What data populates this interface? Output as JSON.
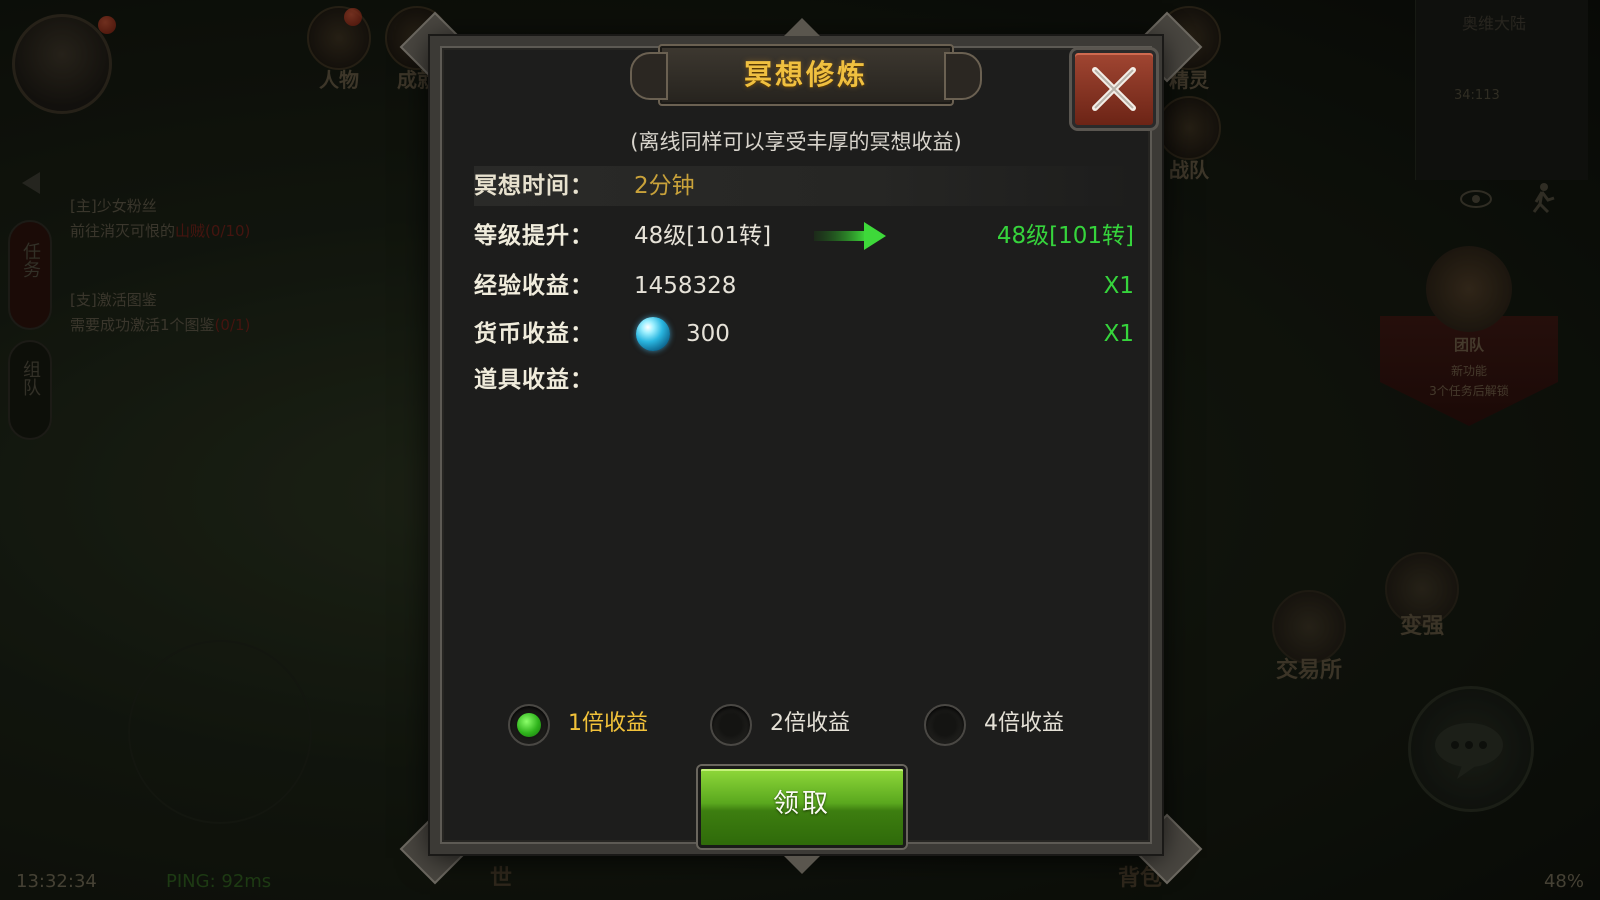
{
  "hud": {
    "top_icons": [
      "人物",
      "成就",
      "精灵",
      "战队"
    ],
    "quests": [
      {
        "title": "[主]少女粉丝",
        "desc": "前往消灭可恨的",
        "progress": "山贼(0/10)"
      },
      {
        "title": "[支]激活图鉴",
        "desc": "需要成功激活1个图鉴",
        "progress": "(0/1)"
      }
    ],
    "quest_tab": "任务",
    "team_tab": "组队",
    "minimap": {
      "name": "奥维大陆",
      "coord": "34:113"
    },
    "guild": {
      "title": "团队",
      "line1": "新功能",
      "line2": "3个任务后解锁"
    },
    "right_buttons": {
      "strengthen": "变强",
      "exchange": "交易所"
    },
    "bottom_labels": {
      "world": "世",
      "bag": "背包"
    },
    "clock": "13:32:34",
    "ping": "PING: 92ms",
    "battery": "48%"
  },
  "dialog": {
    "title": "冥想修炼",
    "subtitle": "(离线同样可以享受丰厚的冥想收益)",
    "rows": {
      "time": {
        "label": "冥想时间：",
        "value": "2分钟"
      },
      "level": {
        "label": "等级提升：",
        "from": "48级[101转]",
        "to": "48级[101转]"
      },
      "exp": {
        "label": "经验收益：",
        "value": "1458328",
        "multiplier": "X1"
      },
      "currency": {
        "label": "货币收益：",
        "value": "300",
        "multiplier": "X1",
        "icon": "blue-orb-icon"
      },
      "items": {
        "label": "道具收益："
      }
    },
    "options": [
      {
        "label": "1倍收益",
        "selected": true
      },
      {
        "label": "2倍收益",
        "selected": false
      },
      {
        "label": "4倍收益",
        "selected": false
      }
    ],
    "claim_label": "领取",
    "colors": {
      "title": "#f0c040",
      "gain": "#36d43c",
      "accent_time": "#c9a23a"
    }
  }
}
